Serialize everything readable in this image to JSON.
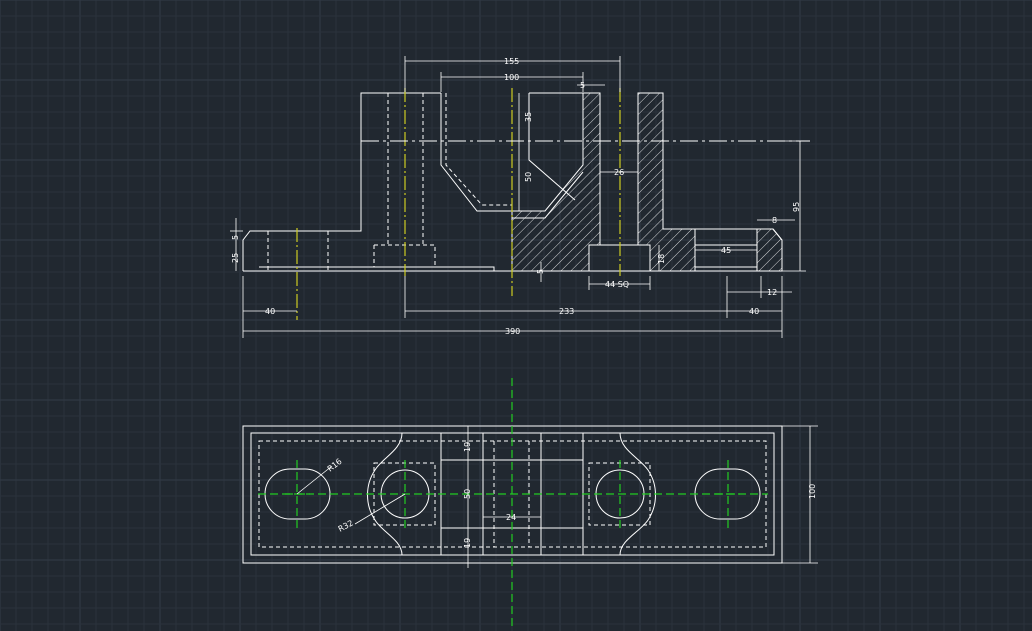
{
  "colors": {
    "background": "#212830",
    "grid_minor": "#2a323c",
    "grid_major": "#323b47",
    "lines": "#ffffff",
    "centerline_front": "#cccc22",
    "centerline_top": "#22cc22"
  },
  "front_view": {
    "dims": {
      "d155": "155",
      "d100": "100",
      "d5": "5",
      "d35": "35",
      "d50": "50",
      "d26": "26",
      "d95": "95",
      "d8": "8",
      "d45": "45",
      "d18": "18",
      "d44sq": "44 SQ",
      "d5b": "5",
      "d12": "12",
      "d25": "25",
      "d5c": "5",
      "d40a": "40",
      "d233": "233",
      "d40b": "40",
      "d390": "390"
    }
  },
  "top_view": {
    "dims": {
      "r16": "R16",
      "r32": "R32",
      "d19a": "19",
      "d50": "50",
      "d19b": "19",
      "d24": "24",
      "d100": "100"
    }
  }
}
